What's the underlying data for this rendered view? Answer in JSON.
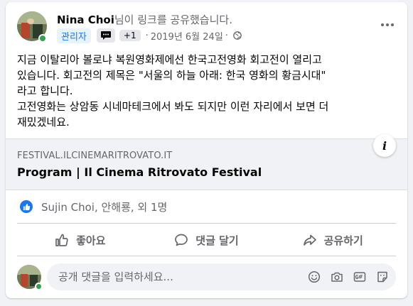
{
  "post": {
    "author": "Nina Choi",
    "action": "님이 링크를 공유했습니다.",
    "role_badge": "관리자",
    "extra_badge": "+1",
    "separator": "·",
    "date": "2019년 6월 24일",
    "text_lines": [
      "지금 이탈리아 볼로냐 복원영화제에선 한국고전영화 회고전이 열리고",
      "있습니다. 회고전의 제목은 \"서울의 하늘 아래: 한국 영화의 황금시대\"",
      "라고 합니다.",
      "고전영화는 상암동 시네마테크에서 봐도 되지만 이런 자리에서 보면 더",
      "재밌겠네요."
    ]
  },
  "link_preview": {
    "domain": "FESTIVAL.ILCINEMARITROVATO.IT",
    "title": "Program | Il Cinema Ritrovato Festival",
    "info_icon_label": "i"
  },
  "reactions": {
    "text": "Sujin Choi, 안해룡, 외 1명"
  },
  "actions": {
    "like": "좋아요",
    "comment": "댓글 달기",
    "share": "공유하기"
  },
  "comment_box": {
    "placeholder": "공개 댓글을 입력하세요..."
  },
  "colors": {
    "accent": "#1877f2",
    "muted": "#65676b",
    "online": "#31a24c"
  },
  "icons": [
    "globe-icon",
    "more-icon",
    "info-icon",
    "like-icon",
    "comment-icon",
    "share-icon",
    "emoji-icon",
    "camera-icon",
    "gif-icon",
    "sticker-icon"
  ]
}
